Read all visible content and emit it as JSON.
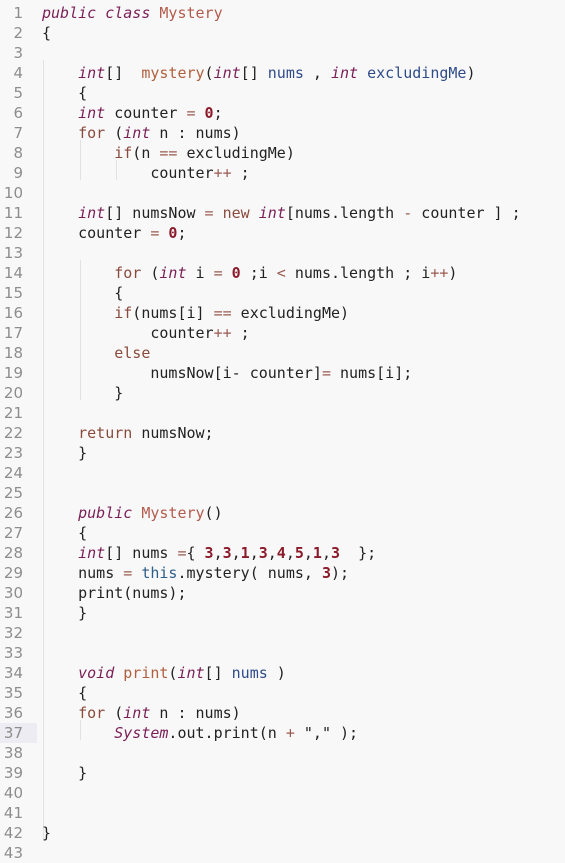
{
  "editor": {
    "active_line": 37,
    "lines": [
      {
        "n": "1",
        "indent": 0,
        "tokens": [
          [
            "kw",
            "public class "
          ],
          [
            "cls",
            "Mystery"
          ]
        ]
      },
      {
        "n": "2",
        "indent": 0,
        "tokens": [
          [
            "txt",
            "{"
          ]
        ]
      },
      {
        "n": "3",
        "indent": 0,
        "tokens": []
      },
      {
        "n": "4",
        "indent": 4,
        "tokens": [
          [
            "kw",
            "int"
          ],
          [
            "txt",
            "[]  "
          ],
          [
            "fn",
            "mystery"
          ],
          [
            "txt",
            "("
          ],
          [
            "kw",
            "int"
          ],
          [
            "txt",
            "[] "
          ],
          [
            "var",
            "nums"
          ],
          [
            "txt",
            " , "
          ],
          [
            "kw",
            "int"
          ],
          [
            "txt",
            " "
          ],
          [
            "var",
            "excludingMe"
          ],
          [
            "txt",
            ")"
          ]
        ]
      },
      {
        "n": "5",
        "indent": 4,
        "tokens": [
          [
            "txt",
            "{"
          ]
        ]
      },
      {
        "n": "6",
        "indent": 4,
        "tokens": [
          [
            "kw",
            "int"
          ],
          [
            "txt",
            " counter "
          ],
          [
            "op",
            "="
          ],
          [
            "txt",
            " "
          ],
          [
            "num",
            "0"
          ],
          [
            "txt",
            ";"
          ]
        ]
      },
      {
        "n": "7",
        "indent": 4,
        "tokens": [
          [
            "kw2",
            "for"
          ],
          [
            "txt",
            " ("
          ],
          [
            "kw",
            "int"
          ],
          [
            "txt",
            " n : nums)"
          ]
        ]
      },
      {
        "n": "8",
        "indent": 8,
        "tokens": [
          [
            "kw2",
            "if"
          ],
          [
            "txt",
            "(n "
          ],
          [
            "op",
            "=="
          ],
          [
            "txt",
            " excludingMe)"
          ]
        ]
      },
      {
        "n": "9",
        "indent": 12,
        "tokens": [
          [
            "txt",
            "counter"
          ],
          [
            "op",
            "++"
          ],
          [
            "txt",
            " ;"
          ]
        ]
      },
      {
        "n": "10",
        "indent": 0,
        "tokens": []
      },
      {
        "n": "11",
        "indent": 4,
        "tokens": [
          [
            "kw",
            "int"
          ],
          [
            "txt",
            "[] numsNow "
          ],
          [
            "op",
            "="
          ],
          [
            "txt",
            " "
          ],
          [
            "kw2",
            "new"
          ],
          [
            "txt",
            " "
          ],
          [
            "kw",
            "int"
          ],
          [
            "txt",
            "[nums.length "
          ],
          [
            "op",
            "-"
          ],
          [
            "txt",
            " counter ] ;"
          ]
        ]
      },
      {
        "n": "12",
        "indent": 4,
        "tokens": [
          [
            "txt",
            "counter "
          ],
          [
            "op",
            "="
          ],
          [
            "txt",
            " "
          ],
          [
            "num",
            "0"
          ],
          [
            "txt",
            ";"
          ]
        ]
      },
      {
        "n": "13",
        "indent": 0,
        "tokens": []
      },
      {
        "n": "14",
        "indent": 8,
        "tokens": [
          [
            "kw2",
            "for"
          ],
          [
            "txt",
            " ("
          ],
          [
            "kw",
            "int"
          ],
          [
            "txt",
            " i "
          ],
          [
            "op",
            "="
          ],
          [
            "txt",
            " "
          ],
          [
            "num",
            "0"
          ],
          [
            "txt",
            " ;i "
          ],
          [
            "op",
            "<"
          ],
          [
            "txt",
            " nums.length ; i"
          ],
          [
            "op",
            "++"
          ],
          [
            "txt",
            ")"
          ]
        ]
      },
      {
        "n": "15",
        "indent": 8,
        "tokens": [
          [
            "txt",
            "{"
          ]
        ]
      },
      {
        "n": "16",
        "indent": 8,
        "tokens": [
          [
            "kw2",
            "if"
          ],
          [
            "txt",
            "(nums[i] "
          ],
          [
            "op",
            "=="
          ],
          [
            "txt",
            " excludingMe)"
          ]
        ]
      },
      {
        "n": "17",
        "indent": 12,
        "tokens": [
          [
            "txt",
            "counter"
          ],
          [
            "op",
            "++"
          ],
          [
            "txt",
            " ;"
          ]
        ]
      },
      {
        "n": "18",
        "indent": 8,
        "tokens": [
          [
            "kw2",
            "else"
          ]
        ]
      },
      {
        "n": "19",
        "indent": 12,
        "tokens": [
          [
            "txt",
            "numsNow[i- counter]"
          ],
          [
            "op",
            "="
          ],
          [
            "txt",
            " nums[i];"
          ]
        ]
      },
      {
        "n": "20",
        "indent": 8,
        "tokens": [
          [
            "txt",
            "}"
          ]
        ]
      },
      {
        "n": "21",
        "indent": 0,
        "tokens": []
      },
      {
        "n": "22",
        "indent": 4,
        "tokens": [
          [
            "kw2",
            "return"
          ],
          [
            "txt",
            " numsNow;"
          ]
        ]
      },
      {
        "n": "23",
        "indent": 4,
        "tokens": [
          [
            "txt",
            "}"
          ]
        ]
      },
      {
        "n": "24",
        "indent": 0,
        "tokens": []
      },
      {
        "n": "25",
        "indent": 0,
        "tokens": []
      },
      {
        "n": "26",
        "indent": 4,
        "tokens": [
          [
            "kw",
            "public"
          ],
          [
            "txt",
            " "
          ],
          [
            "cls",
            "Mystery"
          ],
          [
            "txt",
            "()"
          ]
        ]
      },
      {
        "n": "27",
        "indent": 4,
        "tokens": [
          [
            "txt",
            "{"
          ]
        ]
      },
      {
        "n": "28",
        "indent": 4,
        "tokens": [
          [
            "kw",
            "int"
          ],
          [
            "txt",
            "[] nums "
          ],
          [
            "op",
            "="
          ],
          [
            "txt",
            "{ "
          ],
          [
            "num",
            "3"
          ],
          [
            "txt",
            ","
          ],
          [
            "num",
            "3"
          ],
          [
            "txt",
            ","
          ],
          [
            "num",
            "1"
          ],
          [
            "txt",
            ","
          ],
          [
            "num",
            "3"
          ],
          [
            "txt",
            ","
          ],
          [
            "num",
            "4"
          ],
          [
            "txt",
            ","
          ],
          [
            "num",
            "5"
          ],
          [
            "txt",
            ","
          ],
          [
            "num",
            "1"
          ],
          [
            "txt",
            ","
          ],
          [
            "num",
            "3"
          ],
          [
            "txt",
            "  };"
          ]
        ]
      },
      {
        "n": "29",
        "indent": 4,
        "tokens": [
          [
            "txt",
            "nums "
          ],
          [
            "op",
            "="
          ],
          [
            "txt",
            " "
          ],
          [
            "this",
            "this"
          ],
          [
            "txt",
            ".mystery( nums, "
          ],
          [
            "num",
            "3"
          ],
          [
            "txt",
            ");"
          ]
        ]
      },
      {
        "n": "30",
        "indent": 4,
        "tokens": [
          [
            "txt",
            "print(nums);"
          ]
        ]
      },
      {
        "n": "31",
        "indent": 4,
        "tokens": [
          [
            "txt",
            "}"
          ]
        ]
      },
      {
        "n": "32",
        "indent": 0,
        "tokens": []
      },
      {
        "n": "33",
        "indent": 0,
        "tokens": []
      },
      {
        "n": "34",
        "indent": 4,
        "tokens": [
          [
            "kw",
            "void"
          ],
          [
            "txt",
            " "
          ],
          [
            "fn",
            "print"
          ],
          [
            "txt",
            "("
          ],
          [
            "kw",
            "int"
          ],
          [
            "txt",
            "[] "
          ],
          [
            "var",
            "nums"
          ],
          [
            "txt",
            " )"
          ]
        ]
      },
      {
        "n": "35",
        "indent": 4,
        "tokens": [
          [
            "txt",
            "{"
          ]
        ]
      },
      {
        "n": "36",
        "indent": 4,
        "tokens": [
          [
            "kw2",
            "for"
          ],
          [
            "txt",
            " ("
          ],
          [
            "kw",
            "int"
          ],
          [
            "txt",
            " n : nums)"
          ]
        ]
      },
      {
        "n": "37",
        "indent": 8,
        "tokens": [
          [
            "kw",
            "System"
          ],
          [
            "txt",
            ".out.print(n "
          ],
          [
            "op",
            "+"
          ],
          [
            "txt",
            " \",\" );"
          ]
        ]
      },
      {
        "n": "38",
        "indent": 0,
        "tokens": []
      },
      {
        "n": "39",
        "indent": 4,
        "tokens": [
          [
            "txt",
            "}"
          ]
        ]
      },
      {
        "n": "40",
        "indent": 0,
        "tokens": []
      },
      {
        "n": "41",
        "indent": 0,
        "tokens": []
      },
      {
        "n": "42",
        "indent": 0,
        "tokens": [
          [
            "txt",
            "}"
          ]
        ]
      },
      {
        "n": "43",
        "indent": 0,
        "tokens": []
      }
    ]
  }
}
